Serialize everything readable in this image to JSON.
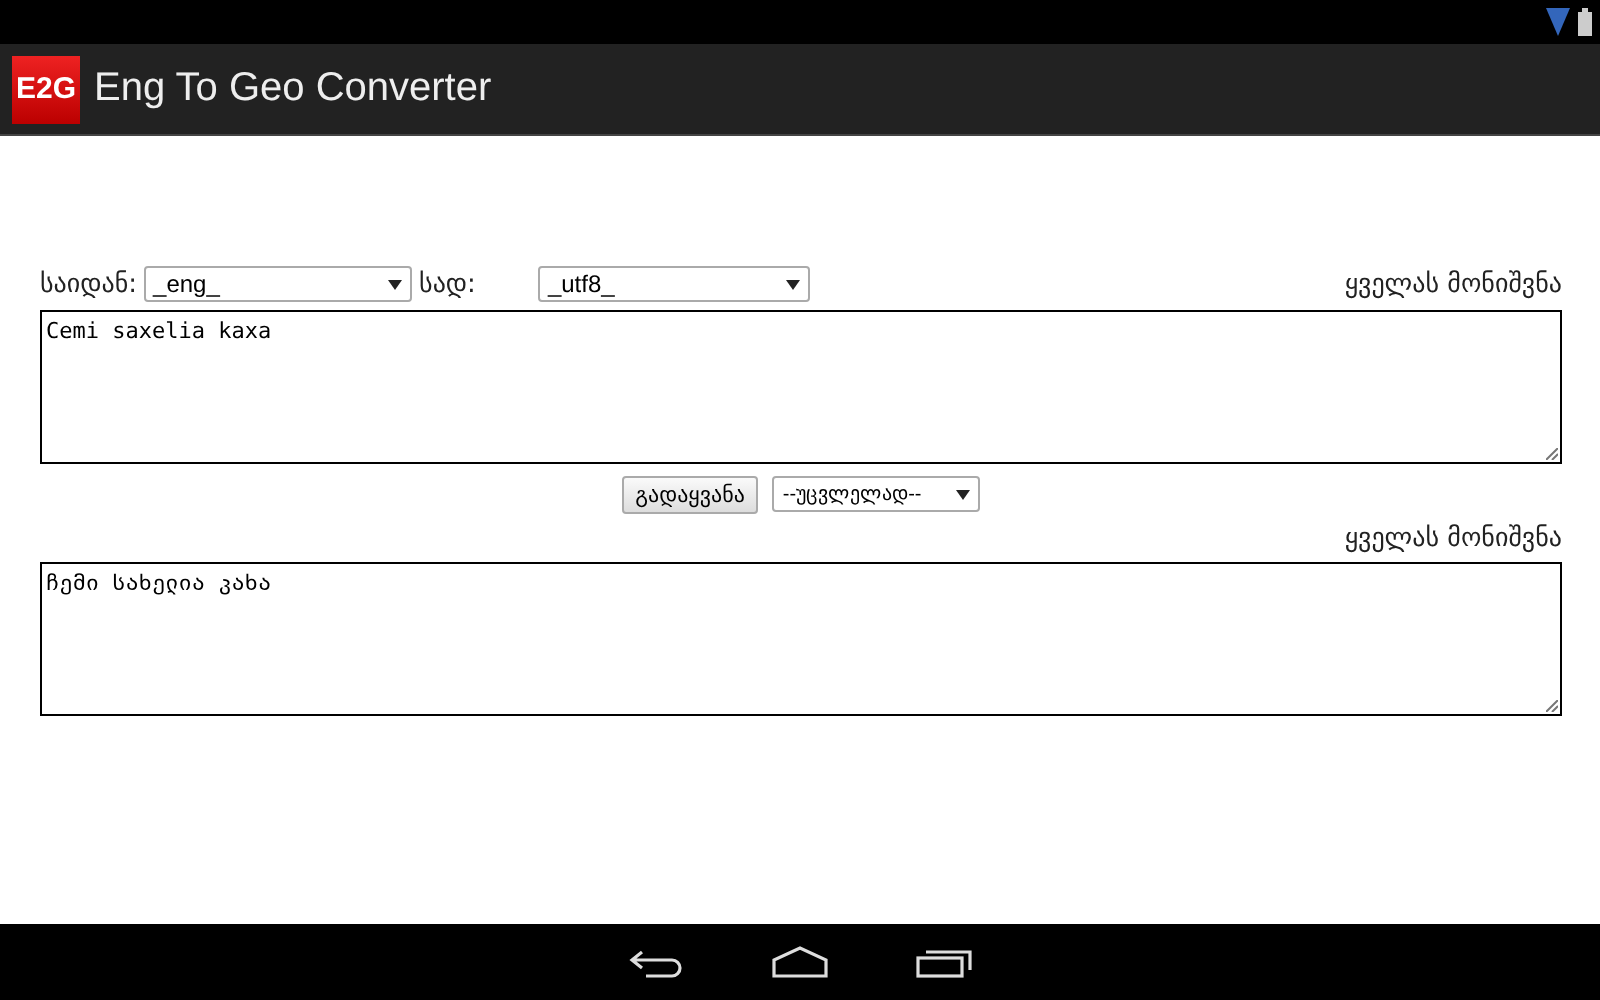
{
  "app_bar": {
    "logo": "E2G",
    "title": "Eng To Geo Converter"
  },
  "source": {
    "from_label": "საიდან:",
    "from_value": "_eng_",
    "to_label": "სად:",
    "to_value": "_utf8_",
    "select_all": "ყველას მონიშვნა",
    "text": "Cemi saxelia kaxa"
  },
  "actions": {
    "convert": "გადაყვანა",
    "mode": "--უცვლელად--"
  },
  "result": {
    "select_all": "ყველას მონიშვნა",
    "text": "ჩემი სახელია კახა"
  }
}
